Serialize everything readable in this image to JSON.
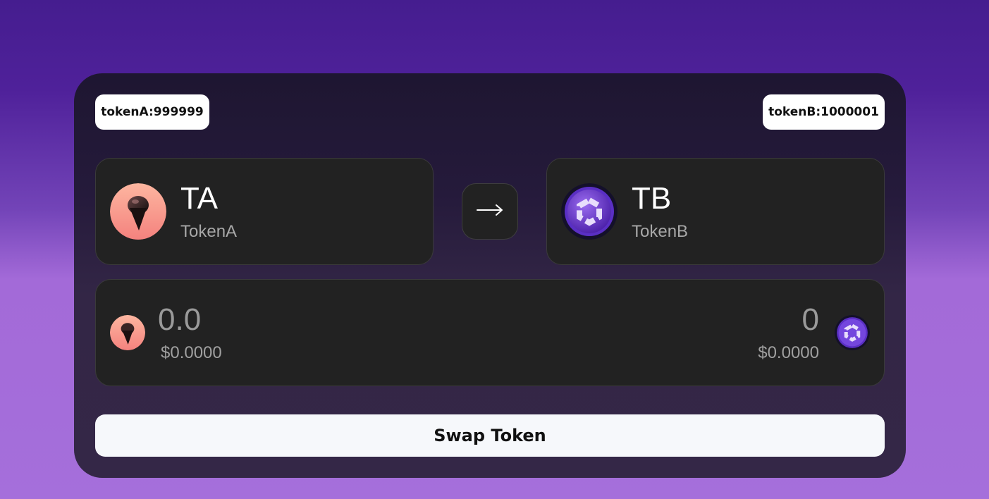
{
  "balances": {
    "tokenA": "tokenA:999999",
    "tokenB": "tokenB:1000001"
  },
  "from_token": {
    "symbol": "TA",
    "name": "TokenA",
    "icon": "ice-cream-token-icon",
    "color": "#f89c8e"
  },
  "to_token": {
    "symbol": "TB",
    "name": "TokenB",
    "icon": "hexagon-token-icon",
    "color": "#6a35d4"
  },
  "swap_direction_icon": "arrow-right-icon",
  "amounts": {
    "input_value": "0.0",
    "input_usd": "$0.0000",
    "output_value": "0",
    "output_usd": "$0.0000"
  },
  "swap_button_label": "Swap Token"
}
